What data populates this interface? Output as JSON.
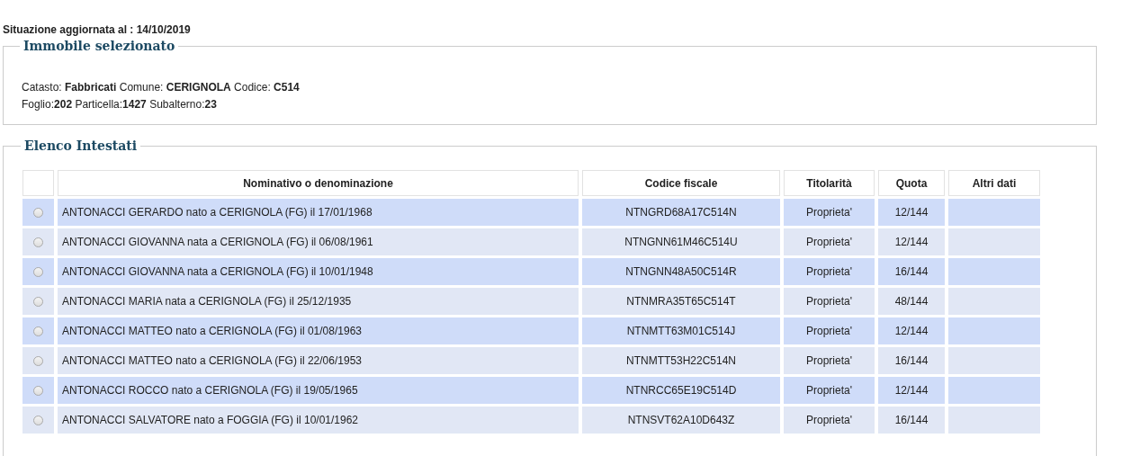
{
  "status_line": "Situazione aggiornata al : 14/10/2019",
  "property": {
    "legend": "Immobile selezionato",
    "lines": [
      "Catasto: **Fabbricati**   Comune: **CERIGNOLA** Codice: **C514**",
      "Foglio:**202** Particella:**1427** Subalterno:**23**"
    ]
  },
  "owners": {
    "legend": "Elenco Intestati",
    "columns": [
      "Nominativo o denominazione",
      "Codice fiscale",
      "Titolarità",
      "Quota",
      "Altri dati"
    ],
    "rows": [
      {
        "selected": false,
        "name": "ANTONACCI GERARDO nato a CERIGNOLA (FG) il 17/01/1968",
        "tax_code": "NTNGRD68A17C514N",
        "title": "Proprieta'",
        "share": "12/144"
      },
      {
        "selected": false,
        "name": "ANTONACCI GIOVANNA nata a CERIGNOLA (FG) il 06/08/1961",
        "tax_code": "NTNGNN61M46C514U",
        "title": "Proprieta'",
        "share": "12/144"
      },
      {
        "selected": false,
        "name": "ANTONACCI GIOVANNA nata a CERIGNOLA (FG) il 10/01/1948",
        "tax_code": "NTNGNN48A50C514R",
        "title": "Proprieta'",
        "share": "16/144"
      },
      {
        "selected": false,
        "name": "ANTONACCI MARIA nata a CERIGNOLA (FG) il 25/12/1935",
        "tax_code": "NTNMRA35T65C514T",
        "title": "Proprieta'",
        "share": "48/144"
      },
      {
        "selected": false,
        "name": "ANTONACCI MATTEO nato a CERIGNOLA (FG) il 01/08/1963",
        "tax_code": "NTNMTT63M01C514J",
        "title": "Proprieta'",
        "share": "12/144"
      },
      {
        "selected": false,
        "name": "ANTONACCI MATTEO nato a CERIGNOLA (FG) il 22/06/1953",
        "tax_code": "NTNMTT53H22C514N",
        "title": "Proprieta'",
        "share": "16/144"
      },
      {
        "selected": false,
        "name": "ANTONACCI ROCCO nato a CERIGNOLA (FG) il 19/05/1965",
        "tax_code": "NTNRCC65E19C514D",
        "title": "Proprieta'",
        "share": "12/144"
      },
      {
        "selected": false,
        "name": "ANTONACCI SALVATORE nato a FOGGIA (FG) il 10/01/1962",
        "tax_code": "NTNSVT62A10D643Z",
        "title": "Proprieta'",
        "share": "16/144"
      }
    ]
  }
}
